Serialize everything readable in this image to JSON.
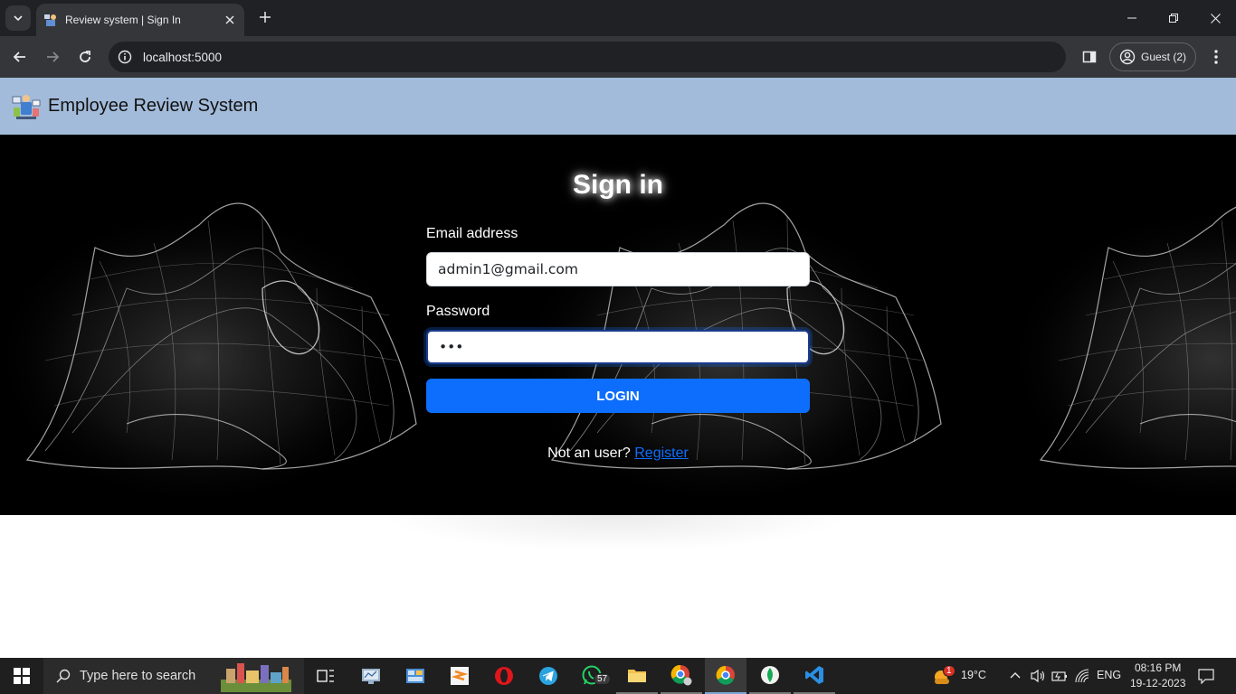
{
  "browser": {
    "tab_title": "Review system | Sign In",
    "url": "localhost:5000",
    "profile_label": "Guest (2)"
  },
  "app": {
    "title": "Employee Review System"
  },
  "form": {
    "heading": "Sign in",
    "email_label": "Email address",
    "email_value": "admin1@gmail.com",
    "password_label": "Password",
    "password_value": "•••",
    "login_label": "LOGIN",
    "register_prompt": "Not an user?",
    "register_link": "Register"
  },
  "taskbar": {
    "search_placeholder": "Type here to search",
    "whatsapp_badge": "57",
    "weather_badge": "1",
    "temperature": "19°C",
    "language": "ENG",
    "time": "08:16 PM",
    "date": "19-12-2023"
  },
  "colors": {
    "header_bg": "#a3bbda",
    "login_button": "#0d6efd",
    "register_link": "#0d6efd"
  }
}
